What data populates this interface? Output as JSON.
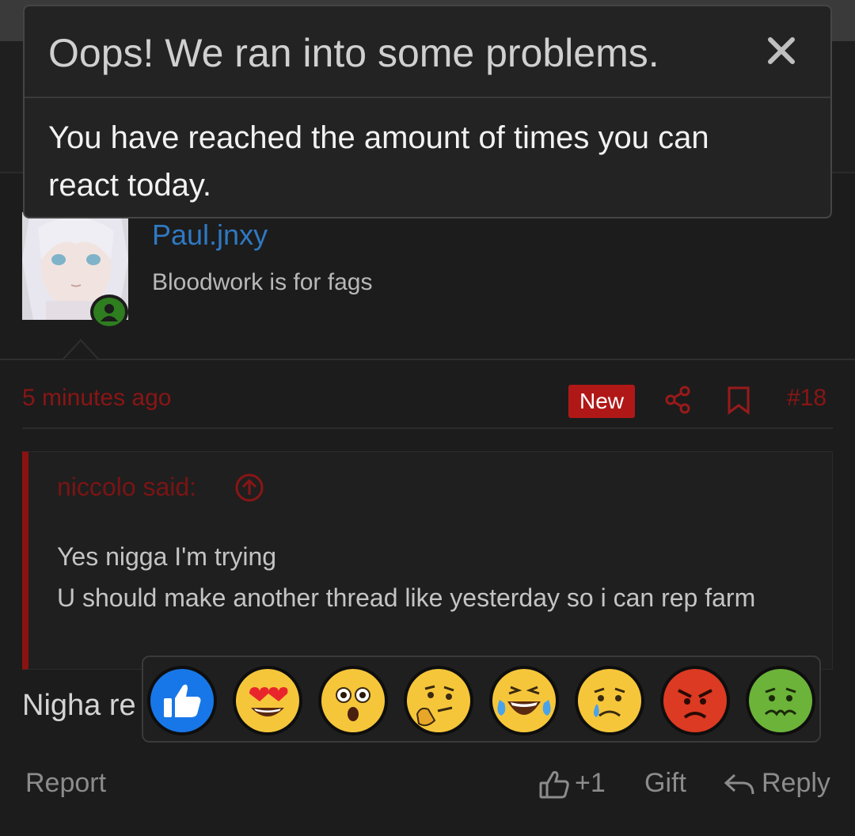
{
  "dialog": {
    "title": "Oops! We ran into some problems.",
    "message": "You have reached the amount of times you can react today.",
    "close_icon": "close-icon"
  },
  "post": {
    "author": {
      "username": "Paul.jnxy",
      "title": "Bloodwork is for fags",
      "online": true
    },
    "timestamp": "5 minutes ago",
    "new_badge": "New",
    "post_number": "#18",
    "quote": {
      "author_label": "niccolo said:",
      "lines": [
        "Yes nigga I'm trying",
        "U should make another thread like yesterday so i can rep farm"
      ]
    },
    "message": "Nigha re",
    "actions": {
      "report": "Report",
      "like_count": "+1",
      "gift": "Gift",
      "reply": "Reply"
    }
  },
  "reactions": [
    {
      "name": "like",
      "icon": "thumbs-up-icon"
    },
    {
      "name": "love",
      "icon": "heart-eyes-icon"
    },
    {
      "name": "wow",
      "icon": "astonished-icon"
    },
    {
      "name": "thinking",
      "icon": "thinking-icon"
    },
    {
      "name": "laugh",
      "icon": "tears-of-joy-icon"
    },
    {
      "name": "sad",
      "icon": "crying-icon"
    },
    {
      "name": "angry",
      "icon": "angry-icon"
    },
    {
      "name": "sick",
      "icon": "nauseated-icon"
    }
  ],
  "colors": {
    "username": "#2f79c2",
    "accent_red": "#b01818",
    "quote_border": "#8b1212",
    "online": "#2e7d1f"
  }
}
